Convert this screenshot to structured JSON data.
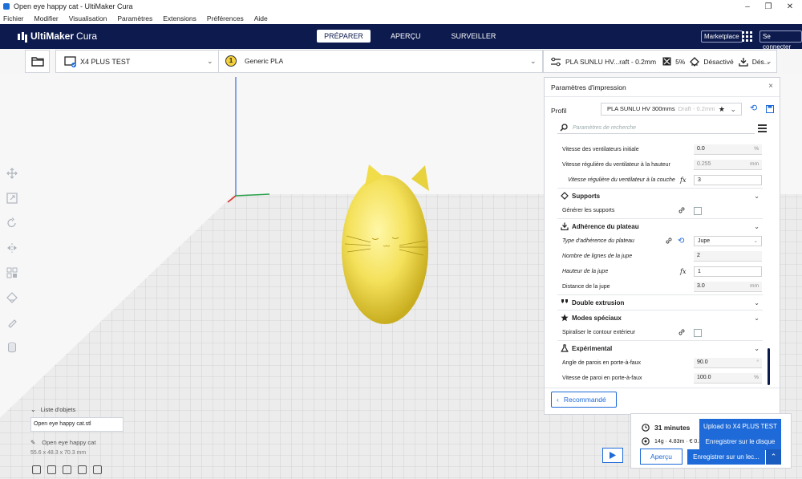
{
  "window": {
    "title": "Open eye happy cat - UltiMaker Cura",
    "minimize": "–",
    "maximize": "❐",
    "close": "✕"
  },
  "menu": [
    "Fichier",
    "Modifier",
    "Visualisation",
    "Paramètres",
    "Extensions",
    "Préférences",
    "Aide"
  ],
  "header": {
    "logo_bold": "UltiMaker",
    "logo_thin": "Cura",
    "tabs": [
      "PRÉPARER",
      "APERÇU",
      "SURVEILLER"
    ],
    "active_tab": "PRÉPARER",
    "marketplace": "Marketplace",
    "login": "Se connecter"
  },
  "toolbar": {
    "printer": "X4 PLUS TEST",
    "material_number": "1",
    "material": "Generic PLA",
    "print_profile": "PLA SUNLU HV...raft - 0.2mm",
    "infill": "5%",
    "support": "Désactivé",
    "adhesion": "Dés..."
  },
  "panel": {
    "title": "Paramètres d'impression",
    "profile_label": "Profil",
    "profile_name": "PLA SUNLU HV  300mms",
    "profile_suffix": "Draft - 0.2mm",
    "search_placeholder": "Paramètres de recherche",
    "settings": [
      {
        "kind": "row",
        "label": "Vitesse des ventilateurs initiale",
        "value": "0.0",
        "unit": "%"
      },
      {
        "kind": "row",
        "label": "Vitesse régulière du ventilateur à la hauteur",
        "value": "0.255",
        "unit": "mm",
        "grey": true
      },
      {
        "kind": "row",
        "label": "Vitesse régulière du ventilateur à la couche",
        "value": "3",
        "unit": "",
        "italic": true,
        "indent": true,
        "fx": true,
        "white": true
      },
      {
        "kind": "cat",
        "label": "Supports",
        "icon": "support-icon"
      },
      {
        "kind": "row",
        "label": "Générer les supports",
        "checkbox": true,
        "link": true
      },
      {
        "kind": "cat",
        "label": "Adhérence du plateau",
        "icon": "adhesion-icon"
      },
      {
        "kind": "row",
        "label": "Type d'adhérence du plateau",
        "value": "Jupe",
        "dropdown": true,
        "italic": true,
        "link": true,
        "reset": true
      },
      {
        "kind": "row",
        "label": "Nombre de lignes de la jupe",
        "value": "2",
        "unit": "",
        "italic": true
      },
      {
        "kind": "row",
        "label": "Hauteur de la jupe",
        "value": "1",
        "unit": "",
        "italic": true,
        "fx": true,
        "white": true
      },
      {
        "kind": "row",
        "label": "Distance de la jupe",
        "value": "3.0",
        "unit": "mm"
      },
      {
        "kind": "cat",
        "label": "Double extrusion",
        "icon": "dual-extrusion-icon"
      },
      {
        "kind": "cat",
        "label": "Modes spéciaux",
        "icon": "star-icon"
      },
      {
        "kind": "row",
        "label": "Spiraliser le contour extérieur",
        "checkbox": true,
        "link": true
      },
      {
        "kind": "cat",
        "label": "Expérimental",
        "icon": "flask-icon"
      },
      {
        "kind": "row",
        "label": "Angle de parois en porte-à-faux",
        "value": "90.0",
        "unit": "°"
      },
      {
        "kind": "row",
        "label": "Vitesse de paroi en porte-à-faux",
        "value": "100.0",
        "unit": "%"
      }
    ],
    "recommended": "Recommandé"
  },
  "objects": {
    "title": "Liste d'objets",
    "file": "Open eye happy cat.stl",
    "name": "Open eye happy cat",
    "dims": "55.6 x 48.3 x 70.3 mm"
  },
  "output": {
    "time": "31 minutes",
    "material": "14g · 4.83m · € 0.33",
    "preview": "Aperçu",
    "upload": "Upload to X4 PLUS TEST",
    "save_disk": "Enregistrer sur le disque",
    "save_on": "Enregistrer sur un lec...",
    "chevron": "⌃"
  },
  "colors": {
    "brand": "#0c1a4e",
    "accent": "#1e6ad8",
    "model": "#f7e661"
  }
}
